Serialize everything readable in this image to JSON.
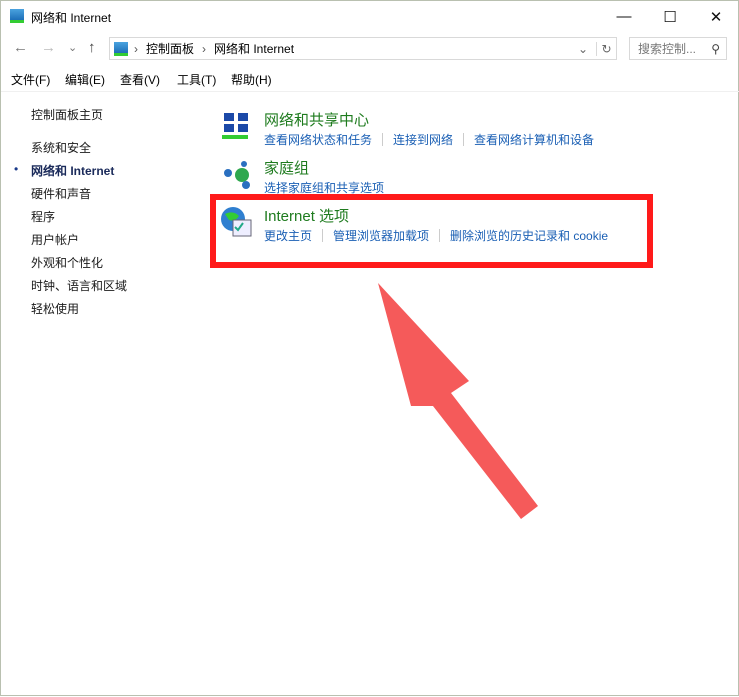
{
  "window": {
    "title": "网络和 Internet",
    "minimize": "—",
    "maximize": "☐",
    "close": "✕"
  },
  "nav": {
    "back": "←",
    "forward": "→",
    "recent": "⌄",
    "up": "↑"
  },
  "address": {
    "crumbs": [
      "控制面板",
      "网络和 Internet"
    ],
    "sep": "›",
    "dropdown": "⌄",
    "refresh": "↻"
  },
  "search": {
    "placeholder": "搜索控制...",
    "icon": "⚲"
  },
  "menu": [
    "文件(F)",
    "编辑(E)",
    "查看(V)",
    "工具(T)",
    "帮助(H)"
  ],
  "sidebar": {
    "home": "控制面板主页",
    "items": [
      "系统和安全",
      "网络和 Internet",
      "硬件和声音",
      "程序",
      "用户帐户",
      "外观和个性化",
      "时钟、语言和区域",
      "轻松使用"
    ],
    "active": 1
  },
  "sections": [
    {
      "title": "网络和共享中心",
      "links": [
        "查看网络状态和任务",
        "连接到网络",
        "查看网络计算机和设备"
      ]
    },
    {
      "title": "家庭组",
      "links": [
        "选择家庭组和共享选项"
      ]
    },
    {
      "title": "Internet 选项",
      "links": [
        "更改主页",
        "管理浏览器加载项",
        "删除浏览的历史记录和 cookie"
      ]
    }
  ],
  "annotation": {
    "highlight_color": "#ff1a1a",
    "arrow_color": "#f55a5a"
  }
}
